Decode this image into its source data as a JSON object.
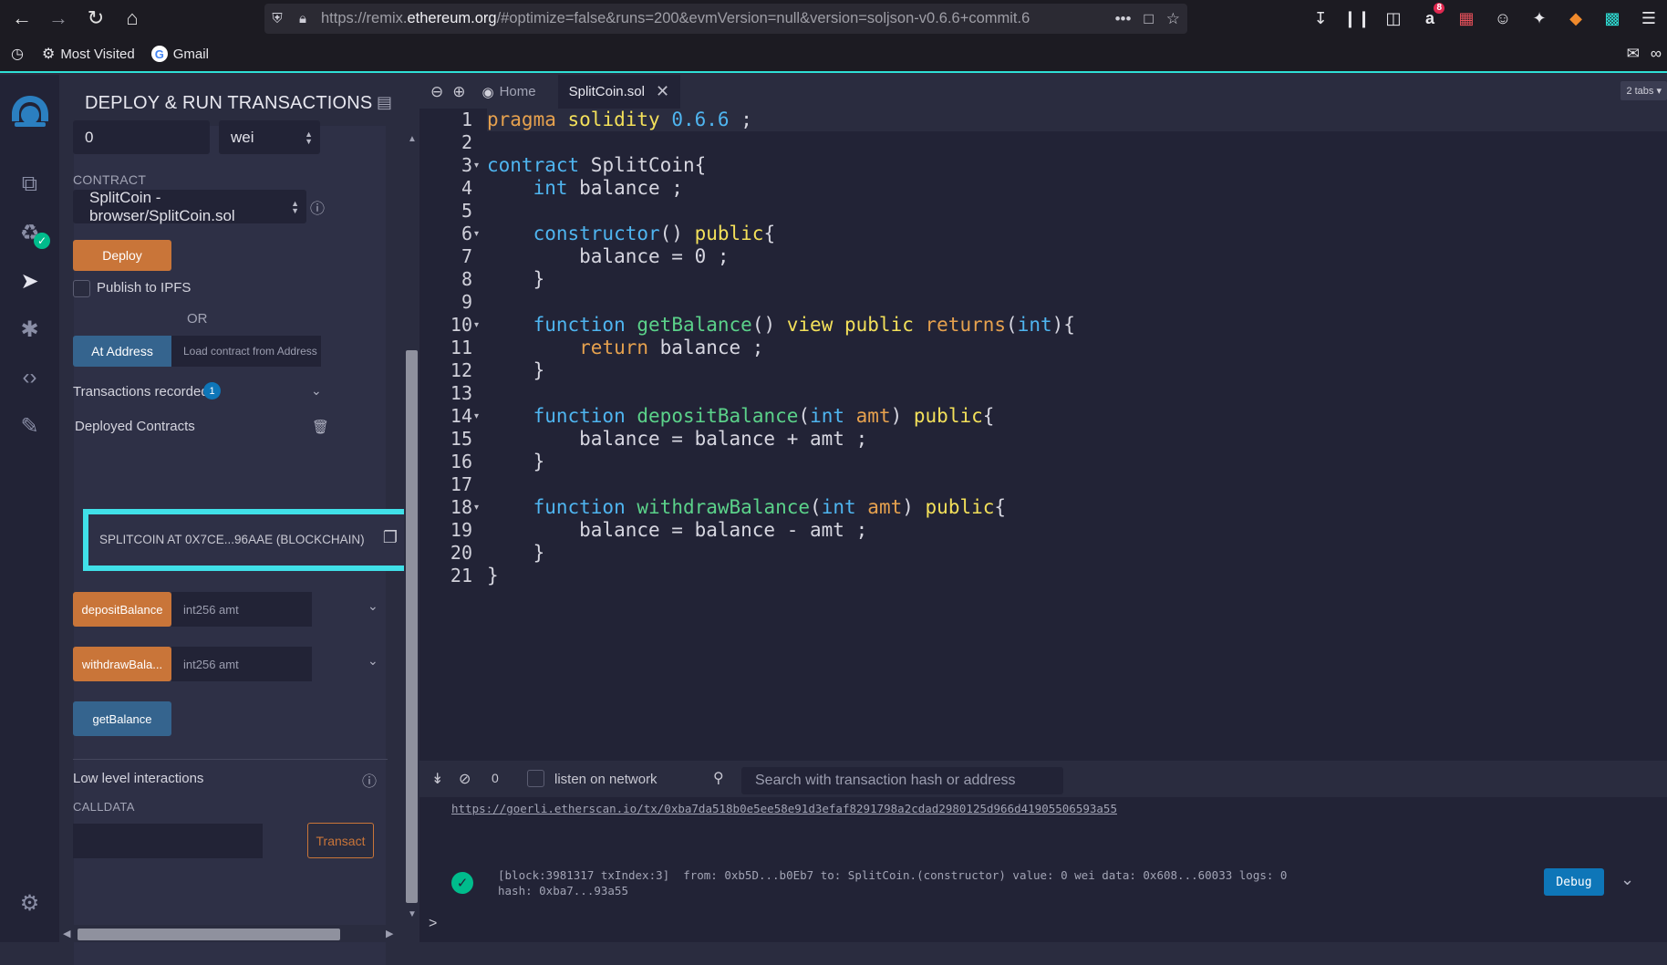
{
  "browser": {
    "url_prefix": "https://remix.",
    "url_host": "ethereum.org",
    "url_rest": "/#optimize=false&runs=200&evmVersion=null&version=soljson-v0.6.6+commit.6",
    "url_more": "•••",
    "amazon_badge": "8",
    "bookmarks": [
      {
        "label": "Most Visited"
      },
      {
        "label": "Gmail"
      }
    ]
  },
  "side_panel": {
    "title": "DEPLOY & RUN TRANSACTIONS",
    "value_input": "0",
    "value_unit": "wei",
    "contract_label": "CONTRACT",
    "contract_selected": "SplitCoin - browser/SplitCoin.sol",
    "deploy_label": "Deploy",
    "publish_ipfs_label": "Publish to IPFS",
    "or_label": "OR",
    "at_address_label": "At Address",
    "at_address_placeholder": "Load contract from Address",
    "tx_recorded_label": "Transactions recorded",
    "tx_recorded_count": "1",
    "deployed_label": "Deployed Contracts",
    "deployed_instance": "SPLITCOIN AT 0X7CE...96AAE (BLOCKCHAIN)",
    "functions": [
      {
        "label": "depositBalance",
        "placeholder": "int256 amt"
      },
      {
        "label": "withdrawBala...",
        "placeholder": "int256 amt"
      },
      {
        "label": "getBalance"
      }
    ],
    "low_level_label": "Low level interactions",
    "calldata_label": "CALLDATA",
    "transact_label": "Transact"
  },
  "editor": {
    "tabs": [
      {
        "label": "Home"
      },
      {
        "label": "SplitCoin.sol"
      }
    ],
    "tabs_count": "2 tabs",
    "line_numbers": [
      "1",
      "2",
      "3",
      "4",
      "5",
      "6",
      "7",
      "8",
      "9",
      "10",
      "11",
      "12",
      "13",
      "14",
      "15",
      "16",
      "17",
      "18",
      "19",
      "20",
      "21"
    ]
  },
  "terminal": {
    "pending_count": "0",
    "listen_label": "listen on network",
    "search_placeholder": "Search with transaction hash or address",
    "tx_link": "https://goerli.etherscan.io/tx/0xba7da518b0e5ee58e91d3efaf8291798a2cdad2980125d966d41905506593a55",
    "log_line1": "[block:3981317 txIndex:3]  from: 0xb5D...b0Eb7 to: SplitCoin.(constructor) value: 0 wei data: 0x608...60033 logs: 0",
    "log_line2": "hash: 0xba7...93a55",
    "debug_label": "Debug",
    "prompt": ">"
  }
}
